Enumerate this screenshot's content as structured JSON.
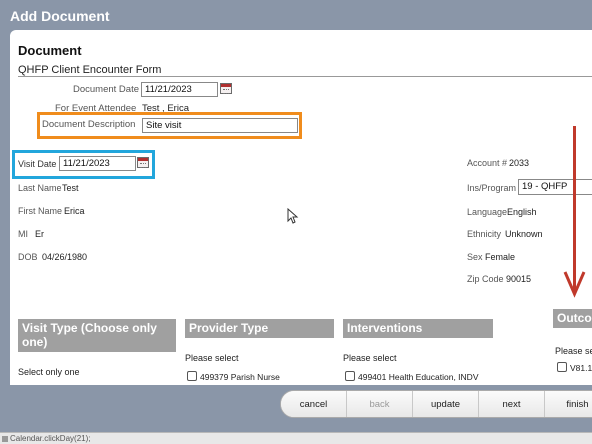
{
  "dialog": {
    "title": "Add Document"
  },
  "document": {
    "heading": "Document",
    "form_name": "QHFP Client Encounter Form",
    "date_label": "Document Date",
    "date_value": "11/21/2023",
    "attendee_label": "For Event Attendee",
    "attendee_value": "Test , Erica",
    "description_label": "Document Description",
    "description_value": "Site visit"
  },
  "visit": {
    "label": "Visit Date",
    "value": "11/21/2023"
  },
  "client": {
    "last_name_label": "Last Name",
    "last_name": "Test",
    "first_name_label": "First Name",
    "first_name": "Erica",
    "mi_label": "MI",
    "mi": "Er",
    "dob_label": "DOB",
    "dob": "04/26/1980"
  },
  "account": {
    "account_label": "Account #",
    "account": "2033",
    "ins_label": "Ins/Program",
    "ins_value": "19 - QHFP",
    "language_label": "Language",
    "language": "English",
    "ethnicity_label": "Ethnicity",
    "ethnicity": "Unknown",
    "sex_label": "Sex",
    "sex": "Female",
    "zip_label": "Zip Code",
    "zip": "90015"
  },
  "sections": {
    "visit_type": {
      "title": "Visit Type (Choose only one)",
      "hint": "Select only one"
    },
    "provider_type": {
      "title": "Provider Type",
      "hint": "Please select",
      "first_item": "499379 Parish Nurse"
    },
    "interventions": {
      "title": "Interventions",
      "hint": "Please select",
      "first_item": "499401 Health Education, INDV"
    },
    "outcomes": {
      "title": "Outco",
      "hint": "Please sele",
      "first_item": "V81.1"
    }
  },
  "buttons": {
    "cancel": "cancel",
    "back": "back",
    "update": "update",
    "next": "next",
    "finish": "finish"
  },
  "status": {
    "text": "Calendar.clickDay(21);"
  },
  "colors": {
    "highlight_orange": "#f08c1c",
    "highlight_blue": "#22a6dc",
    "arrow_red": "#c0392b",
    "section_header": "#a0a0a0"
  }
}
